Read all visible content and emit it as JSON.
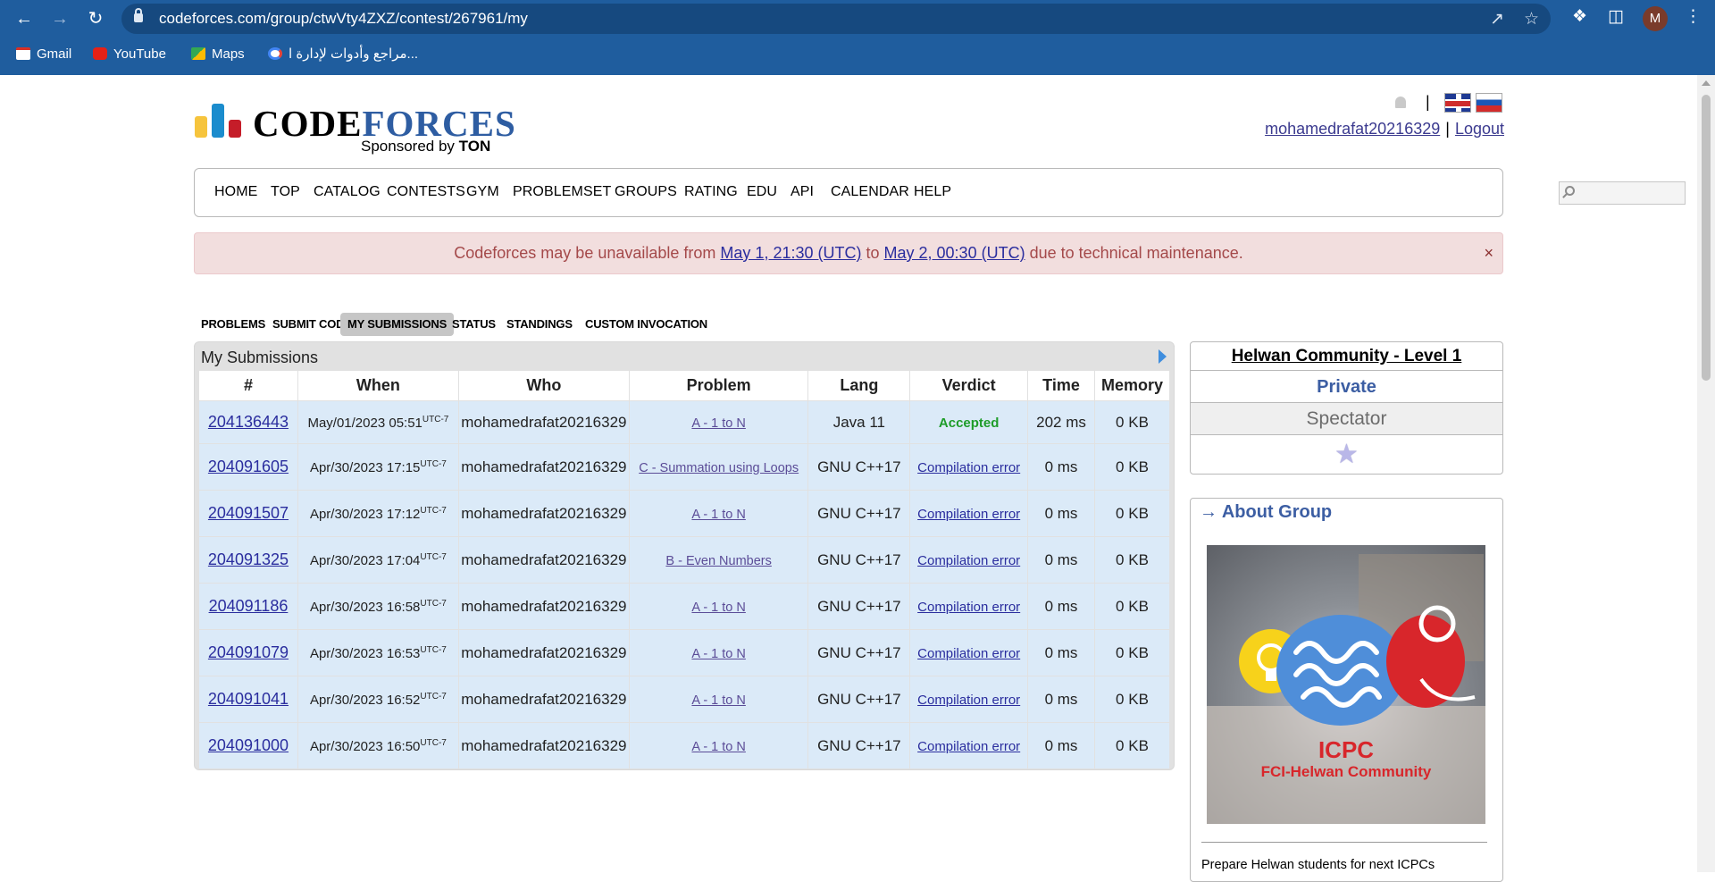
{
  "browser": {
    "url": "codeforces.com/group/ctwVty4ZXZ/contest/267961/my",
    "avatar_letter": "M",
    "bookmarks": [
      {
        "label": "Gmail",
        "icon": "gmail-icon"
      },
      {
        "label": "YouTube",
        "icon": "youtube-icon"
      },
      {
        "label": "Maps",
        "icon": "maps-icon"
      },
      {
        "label": "مراجع وأدوات لإدارة ا...",
        "icon": "google-icon"
      }
    ]
  },
  "header": {
    "logo_code": "CODE",
    "logo_forces": "FORCES",
    "sponsored_prefix": "Sponsored by",
    "sponsored_brand": "TON",
    "username": "mohamedrafat20216329",
    "separator": "|",
    "logout": "Logout"
  },
  "menu": [
    "HOME",
    "TOP",
    "CATALOG",
    "CONTESTS",
    "GYM",
    "PROBLEMSET",
    "GROUPS",
    "RATING",
    "EDU",
    "API",
    "CALENDAR",
    "HELP"
  ],
  "alert": {
    "prefix": "Codeforces may be unavailable from",
    "from": "May 1, 21:30 (UTC)",
    "to_word": "to",
    "to": "May 2, 00:30 (UTC)",
    "suffix": "due to technical maintenance.",
    "close": "×"
  },
  "subtabs": [
    "PROBLEMS",
    "SUBMIT CODE",
    "MY SUBMISSIONS",
    "STATUS",
    "STANDINGS",
    "CUSTOM INVOCATION"
  ],
  "active_subtab": "MY SUBMISSIONS",
  "submissions": {
    "title": "My Submissions",
    "columns": [
      "#",
      "When",
      "Who",
      "Problem",
      "Lang",
      "Verdict",
      "Time",
      "Memory"
    ],
    "rows": [
      {
        "id": "204136443",
        "when": "May/01/2023 05:51",
        "tz": "UTC-7",
        "who": "mohamedrafat20216329",
        "problem": "A - 1 to N",
        "lang": "Java 11",
        "verdict": "Accepted",
        "time": "202 ms",
        "memory": "0 KB"
      },
      {
        "id": "204091605",
        "when": "Apr/30/2023 17:15",
        "tz": "UTC-7",
        "who": "mohamedrafat20216329",
        "problem": "C - Summation using Loops",
        "lang": "GNU C++17",
        "verdict": "Compilation error",
        "time": "0 ms",
        "memory": "0 KB"
      },
      {
        "id": "204091507",
        "when": "Apr/30/2023 17:12",
        "tz": "UTC-7",
        "who": "mohamedrafat20216329",
        "problem": "A - 1 to N",
        "lang": "GNU C++17",
        "verdict": "Compilation error",
        "time": "0 ms",
        "memory": "0 KB"
      },
      {
        "id": "204091325",
        "when": "Apr/30/2023 17:04",
        "tz": "UTC-7",
        "who": "mohamedrafat20216329",
        "problem": "B - Even Numbers",
        "lang": "GNU C++17",
        "verdict": "Compilation error",
        "time": "0 ms",
        "memory": "0 KB"
      },
      {
        "id": "204091186",
        "when": "Apr/30/2023 16:58",
        "tz": "UTC-7",
        "who": "mohamedrafat20216329",
        "problem": "A - 1 to N",
        "lang": "GNU C++17",
        "verdict": "Compilation error",
        "time": "0 ms",
        "memory": "0 KB"
      },
      {
        "id": "204091079",
        "when": "Apr/30/2023 16:53",
        "tz": "UTC-7",
        "who": "mohamedrafat20216329",
        "problem": "A - 1 to N",
        "lang": "GNU C++17",
        "verdict": "Compilation error",
        "time": "0 ms",
        "memory": "0 KB"
      },
      {
        "id": "204091041",
        "when": "Apr/30/2023 16:52",
        "tz": "UTC-7",
        "who": "mohamedrafat20216329",
        "problem": "A - 1 to N",
        "lang": "GNU C++17",
        "verdict": "Compilation error",
        "time": "0 ms",
        "memory": "0 KB"
      },
      {
        "id": "204091000",
        "when": "Apr/30/2023 16:50",
        "tz": "UTC-7",
        "who": "mohamedrafat20216329",
        "problem": "A - 1 to N",
        "lang": "GNU C++17",
        "verdict": "Compilation error",
        "time": "0 ms",
        "memory": "0 KB"
      }
    ]
  },
  "sidebar": {
    "group_title": "Helwan Community - Level 1",
    "privacy": "Private",
    "role": "Spectator",
    "star_icon": "star-icon",
    "about_arrow": "→",
    "about_title": "About Group",
    "image_text_line1": "ICPC",
    "image_text_line2": "FCI-Helwan Community",
    "description": "Prepare Helwan students for next ICPCs"
  },
  "colors": {
    "browser_bar": "#1f5d9e",
    "accent_blue": "#3c5ea3",
    "alert_bg": "#f2dede",
    "row_bg": "#dbeaf8",
    "accepted": "#1d9c28",
    "link": "#2a2d9e"
  }
}
